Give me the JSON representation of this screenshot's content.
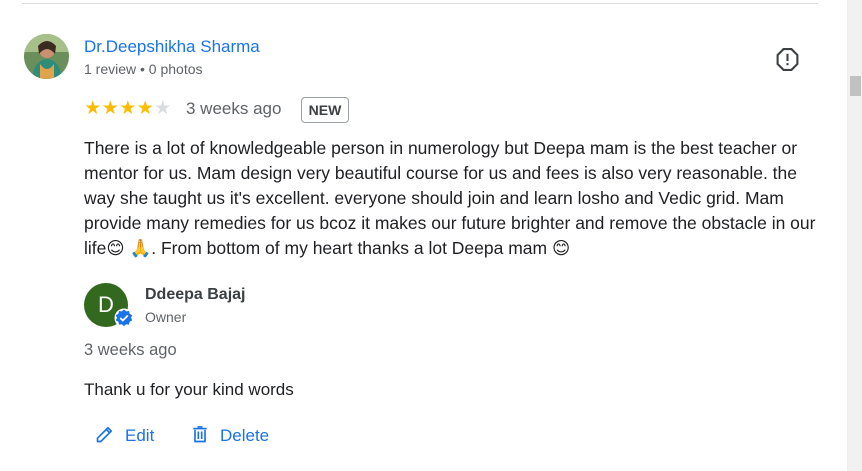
{
  "reviewer": {
    "name": "Dr.Deepshikha Sharma",
    "meta": "1 review • 0 photos"
  },
  "review": {
    "rating": 4,
    "max_rating": 5,
    "star_full": "★",
    "star_empty": "★",
    "time": "3 weeks ago",
    "badge": "NEW",
    "text": "There is a lot of knowledgeable person in numerology but Deepa mam is the best teacher or mentor for us. Mam design very beautiful course for us and fees is also very reasonable. the way she taught us it's excellent. everyone should join and learn losho and Vedic grid. Mam provide many remedies for us bcoz it makes our future brighter and remove the obstacle in our life😊 🙏. From bottom of my heart thanks a lot Deepa mam 😊"
  },
  "owner_reply": {
    "avatar_letter": "D",
    "name": "Ddeepa Bajaj",
    "role": "Owner",
    "time": "3 weeks ago",
    "text": "Thank u for your kind words"
  },
  "actions": {
    "edit_label": "Edit",
    "delete_label": "Delete"
  },
  "colors": {
    "link_blue": "#1a73e8",
    "star_gold": "#fbbc04",
    "star_gray": "#dadce0",
    "owner_avatar_green": "#33691e"
  },
  "icons": {
    "report": "report-flag-icon",
    "verified": "verified-check-icon",
    "edit": "pencil-icon",
    "delete": "trash-icon"
  }
}
